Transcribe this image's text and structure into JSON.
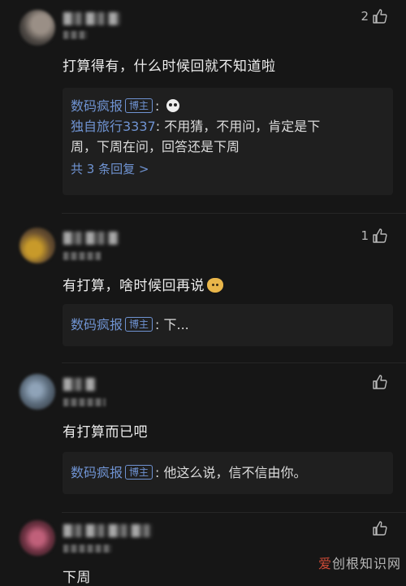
{
  "comments": [
    {
      "text": "打算得有，什么时候回就不知道啦",
      "likes": "2",
      "reply": {
        "author": "数码疯报",
        "badge": "博主",
        "separator": ":",
        "reply_line": {
          "author": "独自旅行3337",
          "separator": ":",
          "text_line1": "不用猜，不用问，肯定是下",
          "text_line2": "周，下周在问，回答还是下周"
        },
        "more": "共 3 条回复 >"
      }
    },
    {
      "text": "有打算，啥时候回再说",
      "likes": "1",
      "reply": {
        "author": "数码疯报",
        "badge": "博主",
        "text": ": 下..."
      }
    },
    {
      "text": "有打算而已吧",
      "likes": "",
      "reply": {
        "author": "数码疯报",
        "badge": "博主",
        "text": ": 他这么说，信不信由你。"
      }
    },
    {
      "text": "下周",
      "likes": ""
    }
  ],
  "watermark": {
    "highlight": "爱",
    "rest": "创根知识网"
  },
  "icons": [
    "thumb-up-icon",
    "emoji-panda-icon",
    "emoji-dog-icon"
  ],
  "colors": {
    "background": "#161616",
    "reply_box": "#1f1f1f",
    "link_blue": "#6f93d2",
    "text": "#ececec"
  }
}
